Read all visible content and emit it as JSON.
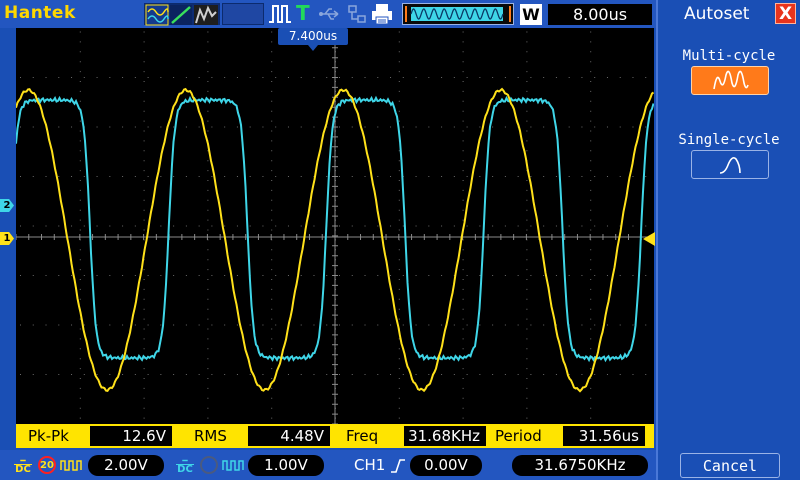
{
  "brand": "Hantek",
  "toolbar": {
    "trigger_indicator": "T",
    "window_label": "W",
    "timebase": "8.00us"
  },
  "screen": {
    "trigger_position": "7.400us",
    "ch1_marker": "1",
    "ch2_marker": "2"
  },
  "measurements": [
    {
      "label": "Pk-Pk",
      "value": "12.6V"
    },
    {
      "label": "RMS",
      "value": "4.48V"
    },
    {
      "label": "Freq",
      "value": "31.68KHz"
    },
    {
      "label": "Period",
      "value": "31.56us"
    }
  ],
  "status": {
    "ch1_coupling": "DC",
    "ch1_bw_limit": "20",
    "ch1_scale": "2.00V",
    "ch2_coupling": "DC",
    "ch2_scale": "1.00V",
    "trigger_source": "CH1",
    "trigger_level": "0.00V",
    "frequency_counter": "31.6750KHz"
  },
  "side_panel": {
    "title": "Autoset",
    "close": "X",
    "multi_cycle_label": "Multi-cycle",
    "single_cycle_label": "Single-cycle",
    "cancel_label": "Cancel"
  },
  "colors": {
    "ch1": "#ffe11a",
    "ch2": "#3fd6e8",
    "frame": "#1a4fb5",
    "accent": "#ff7a1a"
  }
}
